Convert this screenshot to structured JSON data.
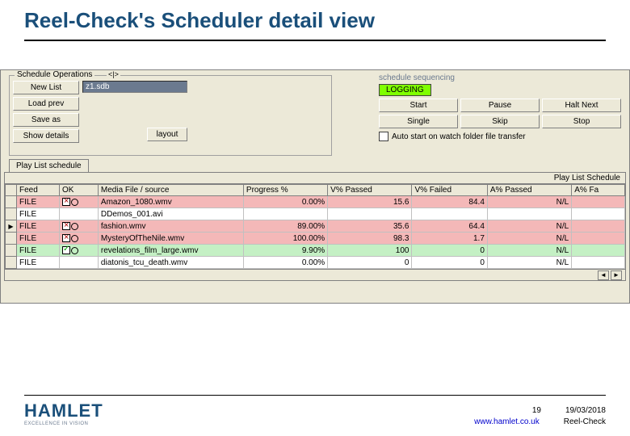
{
  "slide": {
    "title": "Reel-Check's Scheduler detail view"
  },
  "ops": {
    "group_label": "Schedule Operations",
    "nav": "<|>",
    "new_list": "New List",
    "load_prev": "Load prev",
    "save_as": "Save as",
    "show_details": "Show details",
    "file_field": "z1.sdb",
    "layout_btn": "layout"
  },
  "seq": {
    "label": "schedule sequencing",
    "logging": "LOGGING",
    "start": "Start",
    "pause": "Pause",
    "halt_next": "Halt Next",
    "single": "Single",
    "skip": "Skip",
    "stop": "Stop",
    "auto_start": "Auto start on watch folder file transfer"
  },
  "playlist": {
    "tab": "Play List schedule",
    "caption": "Play List Schedule",
    "headers": {
      "feed": "Feed",
      "ok": "OK",
      "media": "Media File / source",
      "progress": "Progress %",
      "vpass": "V% Passed",
      "vfail": "V% Failed",
      "apass": "A% Passed",
      "afail": "A% Fa"
    },
    "rows": [
      {
        "feed": "FILE",
        "ok": "x",
        "media": "Amazon_1080.wmv",
        "progress": "0.00%",
        "vpass": "15.6",
        "vfail": "84.4",
        "apass": "N/L",
        "cls": "row-pink"
      },
      {
        "feed": "FILE",
        "ok": "",
        "media": "DDemos_001.avi",
        "progress": "",
        "vpass": "",
        "vfail": "",
        "apass": "",
        "cls": "row-white"
      },
      {
        "feed": "FILE",
        "ok": "x",
        "media": "fashion.wmv",
        "progress": "89.00%",
        "vpass": "35.6",
        "vfail": "64.4",
        "apass": "N/L",
        "cls": "row-pink",
        "sel": true
      },
      {
        "feed": "FILE",
        "ok": "x",
        "media": "MysteryOfTheNile.wmv",
        "progress": "100.00%",
        "vpass": "98.3",
        "vfail": "1.7",
        "apass": "N/L",
        "cls": "row-pink"
      },
      {
        "feed": "FILE",
        "ok": "check",
        "media": "revelations_film_large.wmv",
        "progress": "9.90%",
        "vpass": "100",
        "vfail": "0",
        "apass": "N/L",
        "cls": "row-green"
      },
      {
        "feed": "FILE",
        "ok": "",
        "media": "diatonis_tcu_death.wmv",
        "progress": "0.00%",
        "vpass": "0",
        "vfail": "0",
        "apass": "N/L",
        "cls": "row-white"
      }
    ]
  },
  "footer": {
    "logo": "HAMLET",
    "tagline": "EXCELLENCE IN VISION",
    "page": "19",
    "date": "19/03/2018",
    "url": "www.hamlet.co.uk",
    "product": "Reel-Check"
  }
}
